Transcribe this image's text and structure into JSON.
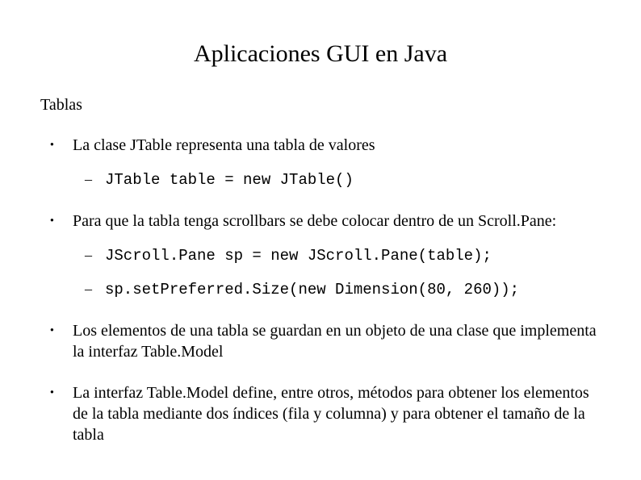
{
  "title": "Aplicaciones GUI en Java",
  "subtitle": "Tablas",
  "bullets": [
    {
      "text": "La clase JTable representa una tabla de valores",
      "subs": [
        "JTable table = new JTable()"
      ]
    },
    {
      "text": "Para que la tabla tenga scrollbars se debe colocar dentro de un Scroll.Pane:",
      "subs": [
        "JScroll.Pane sp = new JScroll.Pane(table);",
        "sp.setPreferred.Size(new Dimension(80, 260));"
      ]
    },
    {
      "text": "Los elementos de una tabla se guardan en un objeto de una clase que implementa la interfaz Table.Model",
      "subs": []
    },
    {
      "text": "La interfaz Table.Model define, entre otros, métodos para obtener los elementos de la tabla mediante dos índices (fila y columna) y para obtener el tamaño de la tabla",
      "subs": []
    }
  ]
}
